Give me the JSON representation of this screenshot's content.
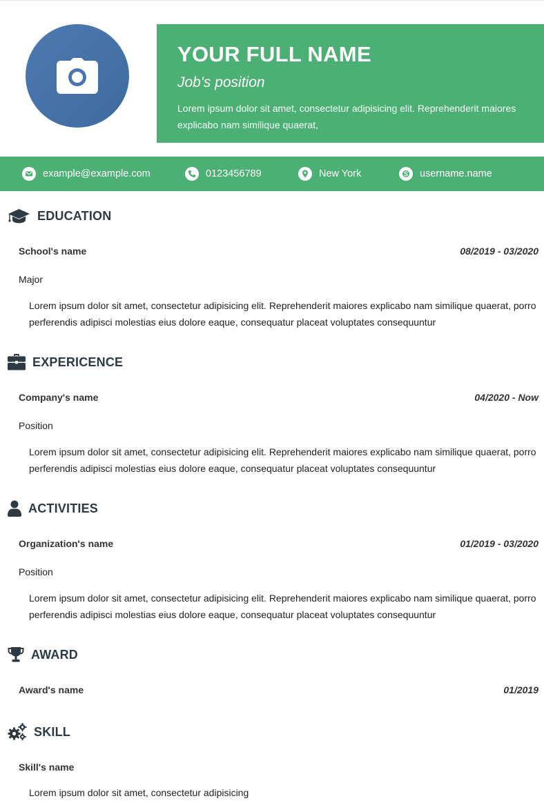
{
  "header": {
    "name": "YOUR FULL NAME",
    "position": "Job's position",
    "summary": "Lorem ipsum dolor sit amet, consectetur adipisicing elit. Reprehenderit maiores explicabo nam similique quaerat,",
    "avatar_icon": "camera-icon"
  },
  "contact": {
    "email": "example@example.com",
    "phone": "0123456789",
    "location": "New York",
    "skype": "username.name"
  },
  "education": {
    "title": "EDUCATION",
    "name": "School's name",
    "date": "08/2019 - 03/2020",
    "sub": "Major",
    "desc": "Lorem ipsum dolor sit amet, consectetur adipisicing elit. Reprehenderit maiores explicabo nam similique quaerat, porro perferendis adipisci molestias eius dolore eaque, consequatur placeat voluptates consequuntur"
  },
  "experience": {
    "title": "EXPERICENCE",
    "name": "Company's name",
    "date": "04/2020 - Now",
    "sub": "Position",
    "desc": "Lorem ipsum dolor sit amet, consectetur adipisicing elit. Reprehenderit maiores explicabo nam similique quaerat, porro perferendis adipisci molestias eius dolore eaque, consequatur placeat voluptates consequuntur"
  },
  "activities": {
    "title": "ACTIVITIES",
    "name": "Organization's name",
    "date": "01/2019 - 03/2020",
    "sub": "Position",
    "desc": "Lorem ipsum dolor sit amet, consectetur adipisicing elit. Reprehenderit maiores explicabo nam similique quaerat, porro perferendis adipisci molestias eius dolore eaque, consequatur placeat voluptates consequuntur"
  },
  "award": {
    "title": "AWARD",
    "name": "Award's name",
    "date": "01/2019"
  },
  "skill": {
    "title": "SKILL",
    "name": "Skill's name",
    "desc": "Lorem ipsum dolor sit amet, consectetur adipisicing"
  },
  "colors": {
    "accent_green": "#4caf73",
    "avatar_blue": "#4a76ad",
    "heading_dark": "#2d3a44"
  }
}
